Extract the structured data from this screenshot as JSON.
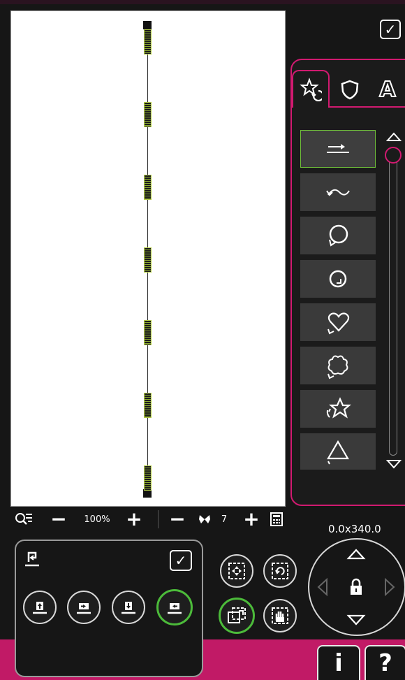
{
  "toolbar": {
    "zoom_out_label": "−",
    "zoom_value": "100%",
    "zoom_in_label": "+",
    "stitch_minus_label": "−",
    "stitch_count": "7",
    "stitch_plus_label": "+"
  },
  "top": {
    "confirm_label": "✓"
  },
  "tabs": [
    {
      "name": "tab-shape-star",
      "icon": "star-rotate-icon"
    },
    {
      "name": "tab-shield",
      "icon": "shield-icon"
    },
    {
      "name": "tab-text",
      "icon": "letter-a-icon",
      "label": "A"
    }
  ],
  "shapes": [
    {
      "icon": "line-arrow-icon"
    },
    {
      "icon": "wave-icon"
    },
    {
      "icon": "circle-icon"
    },
    {
      "icon": "circle-arrow-icon"
    },
    {
      "icon": "heart-icon"
    },
    {
      "icon": "flower-icon"
    },
    {
      "icon": "star-icon"
    },
    {
      "icon": "triangle-icon"
    }
  ],
  "bottom_panel": {
    "confirm_label": "✓"
  },
  "position": {
    "coordinates": "0.0x340.0"
  },
  "help": {
    "info_label": "i",
    "help_label": "?"
  },
  "colors": {
    "accent": "#d11a70",
    "selected": "#4cbb3a",
    "stitch": "#b8d14a"
  }
}
